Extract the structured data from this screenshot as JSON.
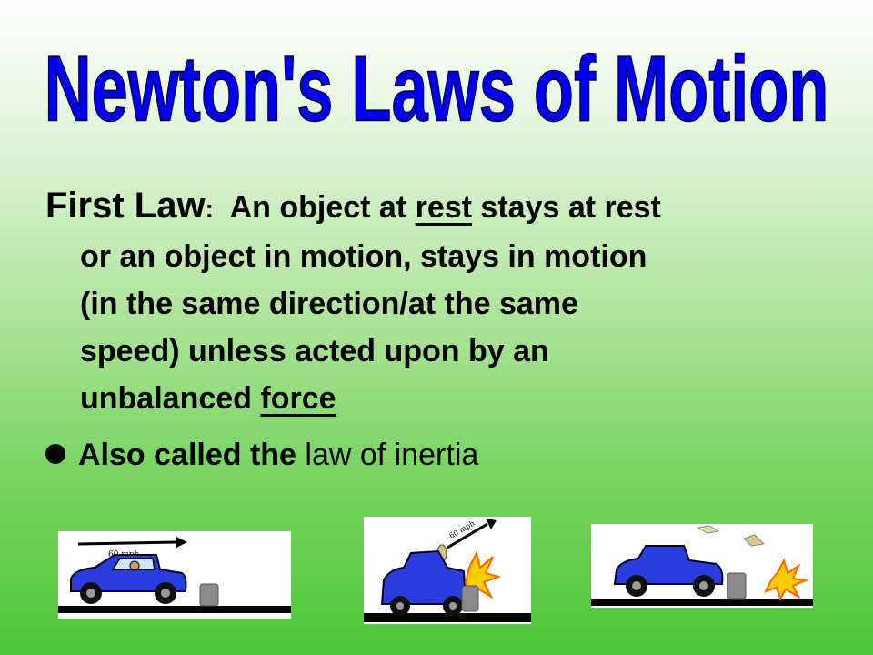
{
  "title": "Newton's Laws of Motion",
  "first_law": {
    "label": "First Law",
    "colon": ":",
    "text_1": "An object at",
    "word_rest": "rest",
    "text_2": "stays at rest",
    "text_3": "or an object in motion, stays in motion",
    "text_4": "(in the same direction/at the same",
    "text_5": "speed) unless acted upon by an",
    "text_6": "unbalanced",
    "word_force": "force"
  },
  "bullet": {
    "bold_text": "Also called the",
    "normal_text": "law of inertia"
  },
  "illustrations": {
    "speed_label_1": "60 mph",
    "speed_label_2": "60 mph"
  },
  "colors": {
    "title": "#0000ee",
    "car": "#2233dd",
    "background_top": "#ffffff",
    "background_bottom": "#4cc63a"
  }
}
